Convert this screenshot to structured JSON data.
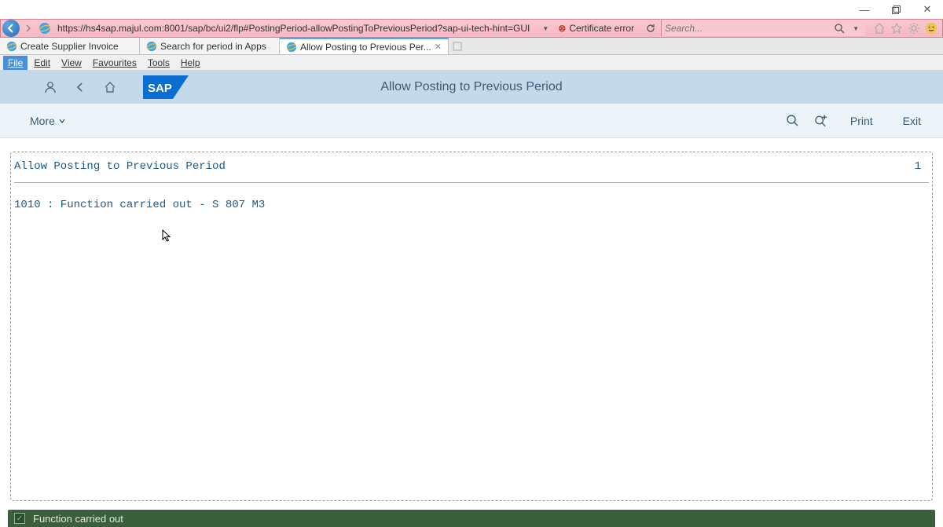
{
  "window": {
    "minimize": "—",
    "maximize": "🗖",
    "close": "✕"
  },
  "nav": {
    "url": "https://hs4sap.majul.com:8001/sap/bc/ui2/flp#PostingPeriod-allowPostingToPreviousPeriod?sap-ui-tech-hint=GUI",
    "cert_text": "Certificate error",
    "search_placeholder": "Search..."
  },
  "tabs": [
    {
      "label": "Create Supplier Invoice"
    },
    {
      "label": "Search for period in Apps"
    },
    {
      "label": "Allow Posting to Previous Per..."
    }
  ],
  "menus": {
    "file": "File",
    "edit": "Edit",
    "view": "View",
    "favourites": "Favourites",
    "tools": "Tools",
    "help": "Help"
  },
  "sap": {
    "title": "Allow Posting to Previous Period",
    "more": "More"
  },
  "toolbar": {
    "print": "Print",
    "exit": "Exit"
  },
  "content": {
    "heading": "Allow Posting to Previous Period",
    "page": "1",
    "message": "1010 : Function carried out - S 807 M3"
  },
  "status": {
    "text": "Function carried out"
  }
}
